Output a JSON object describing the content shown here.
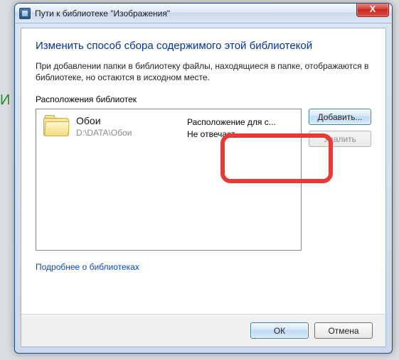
{
  "titlebar": {
    "title": "Пути к библиотеке \"Изображения\"",
    "close": "X"
  },
  "heading": "Изменить способ сбора содержимого этой библиотекой",
  "description": "При добавлении папки в библиотеку файлы, находящиеся в папке, отображаются в библиотеке, но остаются в исходном месте.",
  "list_label": "Расположения библиотек",
  "entry": {
    "name": "Обои",
    "path": "D:\\DATA\\Обои",
    "status1": "Расположение для с...",
    "status2": "Не отвечает"
  },
  "buttons": {
    "add": "Добавить...",
    "remove": "Удалить",
    "ok": "ОК",
    "cancel": "Отмена"
  },
  "link": "Подробнее о библиотеках",
  "bg_letter": "И"
}
